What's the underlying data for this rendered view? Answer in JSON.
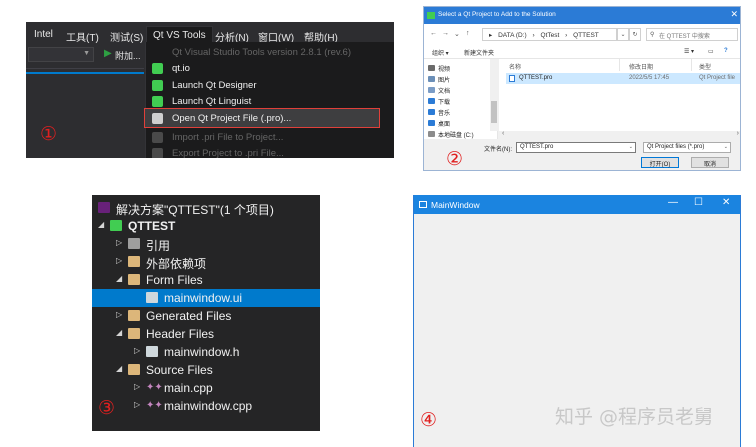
{
  "panel1": {
    "menubar": [
      {
        "label": "Intel"
      },
      {
        "label": "工具(T)"
      },
      {
        "label": "测试(S)"
      },
      {
        "label": "Qt VS Tools"
      },
      {
        "label": "分析(N)"
      },
      {
        "label": "窗口(W)"
      },
      {
        "label": "帮助(H)"
      }
    ],
    "run_label": "附加...",
    "menu_items": [
      {
        "label": "Qt Visual Studio Tools version 2.8.1 (rev.6)",
        "enabled": false,
        "icon_color": "#1b1b1c"
      },
      {
        "label": "qt.io",
        "enabled": true,
        "icon_color": "#41cd52"
      },
      {
        "label": "Launch Qt Designer",
        "enabled": true,
        "icon_color": "#41cd52"
      },
      {
        "label": "Launch Qt Linguist",
        "enabled": true,
        "icon_color": "#41cd52"
      },
      {
        "label": "Open Qt Project File (.pro)...",
        "enabled": true,
        "icon_color": "#cfcfcf",
        "highlighted": true
      },
      {
        "label": "Import .pri File to Project...",
        "enabled": false,
        "icon_color": "#4a4a4a"
      },
      {
        "label": "Export Project to .pri File...",
        "enabled": false,
        "icon_color": "#4a4a4a"
      }
    ],
    "step": "①"
  },
  "panel2": {
    "title": "Select a Qt Project to Add to the Solution",
    "breadcrumb": [
      "DATA (D:)",
      "›",
      "QtTest",
      "›",
      "QTTEST"
    ],
    "search_placeholder": "在 QTTEST 中搜索",
    "cmd_organize": "组织 ▾",
    "cmd_newfolder": "新建文件夹",
    "sidebar": [
      {
        "label": "视频",
        "color": "#6b6b6b"
      },
      {
        "label": "图片",
        "color": "#6b8fb8"
      },
      {
        "label": "文档",
        "color": "#7a9cc6"
      },
      {
        "label": "下载",
        "color": "#2b7bd6"
      },
      {
        "label": "音乐",
        "color": "#2b7bd6"
      },
      {
        "label": "桌面",
        "color": "#2b7bd6"
      },
      {
        "label": "本地磁盘 (C:)",
        "color": "#8c8c8c"
      }
    ],
    "columns": {
      "name": "名称",
      "date": "修改日期",
      "type": "类型"
    },
    "file": {
      "name": "QTTEST.pro",
      "date": "2022/5/5 17:45",
      "type": "Qt Project file"
    },
    "filename_label": "文件名(N):",
    "filename_value": "QTTEST.pro",
    "filter_value": "Qt Project files (*.pro)",
    "open_button": "打开(O)",
    "cancel_button": "取消",
    "step": "②"
  },
  "panel3": {
    "rows": [
      {
        "label": "解决方案\"QTTEST\"(1 个项目)",
        "indent": 0,
        "expander": "",
        "icon_color": "#68217a",
        "bold": false
      },
      {
        "label": "QTTEST",
        "indent": 0,
        "expander": "◢",
        "icon_color": "#41cd52",
        "bold": true
      },
      {
        "label": "引用",
        "indent": 1,
        "expander": "▷",
        "icon_color": "#9e9e9e",
        "bold": false
      },
      {
        "label": "外部依赖项",
        "indent": 1,
        "expander": "▷",
        "icon_color": "#dcb67a",
        "bold": false
      },
      {
        "label": "Form Files",
        "indent": 1,
        "expander": "◢",
        "icon_color": "#dcb67a",
        "bold": false
      },
      {
        "label": "mainwindow.ui",
        "indent": 2,
        "expander": "",
        "icon_color": "#cfd8dc",
        "bold": false,
        "selected": true
      },
      {
        "label": "Generated Files",
        "indent": 1,
        "expander": "▷",
        "icon_color": "#dcb67a",
        "bold": false
      },
      {
        "label": "Header Files",
        "indent": 1,
        "expander": "◢",
        "icon_color": "#dcb67a",
        "bold": false
      },
      {
        "label": "mainwindow.h",
        "indent": 2,
        "expander": "▷",
        "icon_color": "#cfd8dc",
        "bold": false
      },
      {
        "label": "Source Files",
        "indent": 1,
        "expander": "◢",
        "icon_color": "#dcb67a",
        "bold": false
      },
      {
        "label": "main.cpp",
        "indent": 2,
        "expander": "▷",
        "icon_color": "cpp",
        "bold": false
      },
      {
        "label": "mainwindow.cpp",
        "indent": 2,
        "expander": "▷",
        "icon_color": "cpp",
        "bold": false
      }
    ],
    "step": "③"
  },
  "panel4": {
    "title": "MainWindow",
    "minimize": "—",
    "maximize": "☐",
    "close": "✕",
    "step": "④"
  },
  "watermark": "知乎 @程序员老舅"
}
